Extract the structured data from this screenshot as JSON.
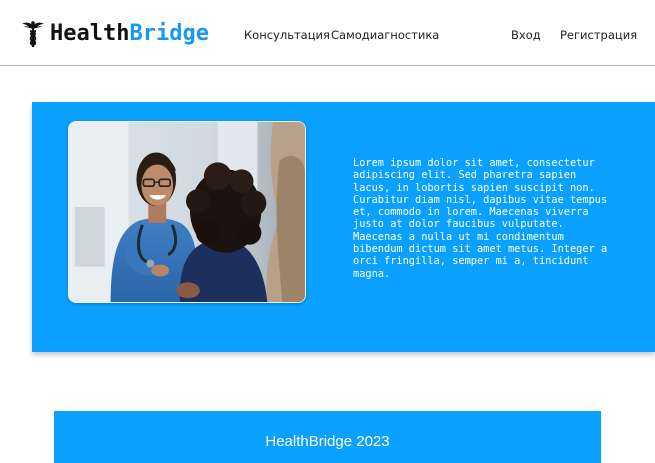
{
  "header": {
    "logo": {
      "icon": "caduceus-icon",
      "text_part_1": "Health",
      "text_part_2": "Bridge"
    },
    "nav": {
      "consultation": "Консультация",
      "self_diagnosis": "Самодиагностика",
      "login": "Вход",
      "register": "Регистрация"
    }
  },
  "hero": {
    "image": "doctor-consulting-patient-photo",
    "text": "Lorem ipsum dolor sit amet, consectetur adipiscing elit. Sed pharetra sapien lacus, in lobortis sapien suscipit non. Curabitur diam nisl, dapibus vitae tempus et, commodo in lorem. Maecenas viverra justo at dolor faucibus vulputate. Maecenas a nulla ut mi condimentum bibendum dictum sit amet metus. Integer a orci fringilla, semper mi a, tincidunt magna."
  },
  "footer": {
    "text": "HealthBridge 2023"
  },
  "colors": {
    "brand_blue": "#0aa0ff",
    "logo_blue": "#1898f2",
    "text_dark": "#222222",
    "white": "#ffffff"
  }
}
